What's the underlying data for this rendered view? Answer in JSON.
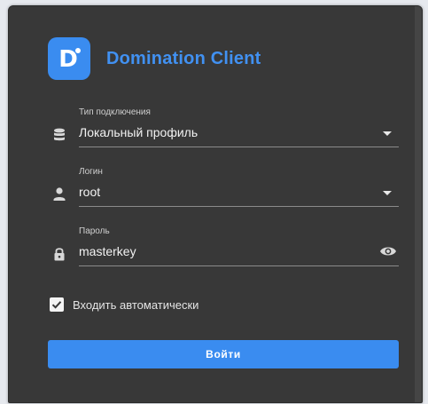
{
  "app": {
    "logo_letter": "D",
    "title": "Domination Client",
    "accent_color": "#3a8cf0"
  },
  "form": {
    "connection_type": {
      "label": "Тип подключения",
      "value": "Локальный профиль",
      "icon": "database-icon"
    },
    "login": {
      "label": "Логин",
      "value": "root",
      "icon": "person-icon"
    },
    "password": {
      "label": "Пароль",
      "value": "masterkey",
      "icon": "lock-icon",
      "toggle_icon": "eye-icon"
    },
    "auto_login": {
      "label": "Входить автоматически",
      "checked": true
    },
    "submit_label": "Войти"
  }
}
